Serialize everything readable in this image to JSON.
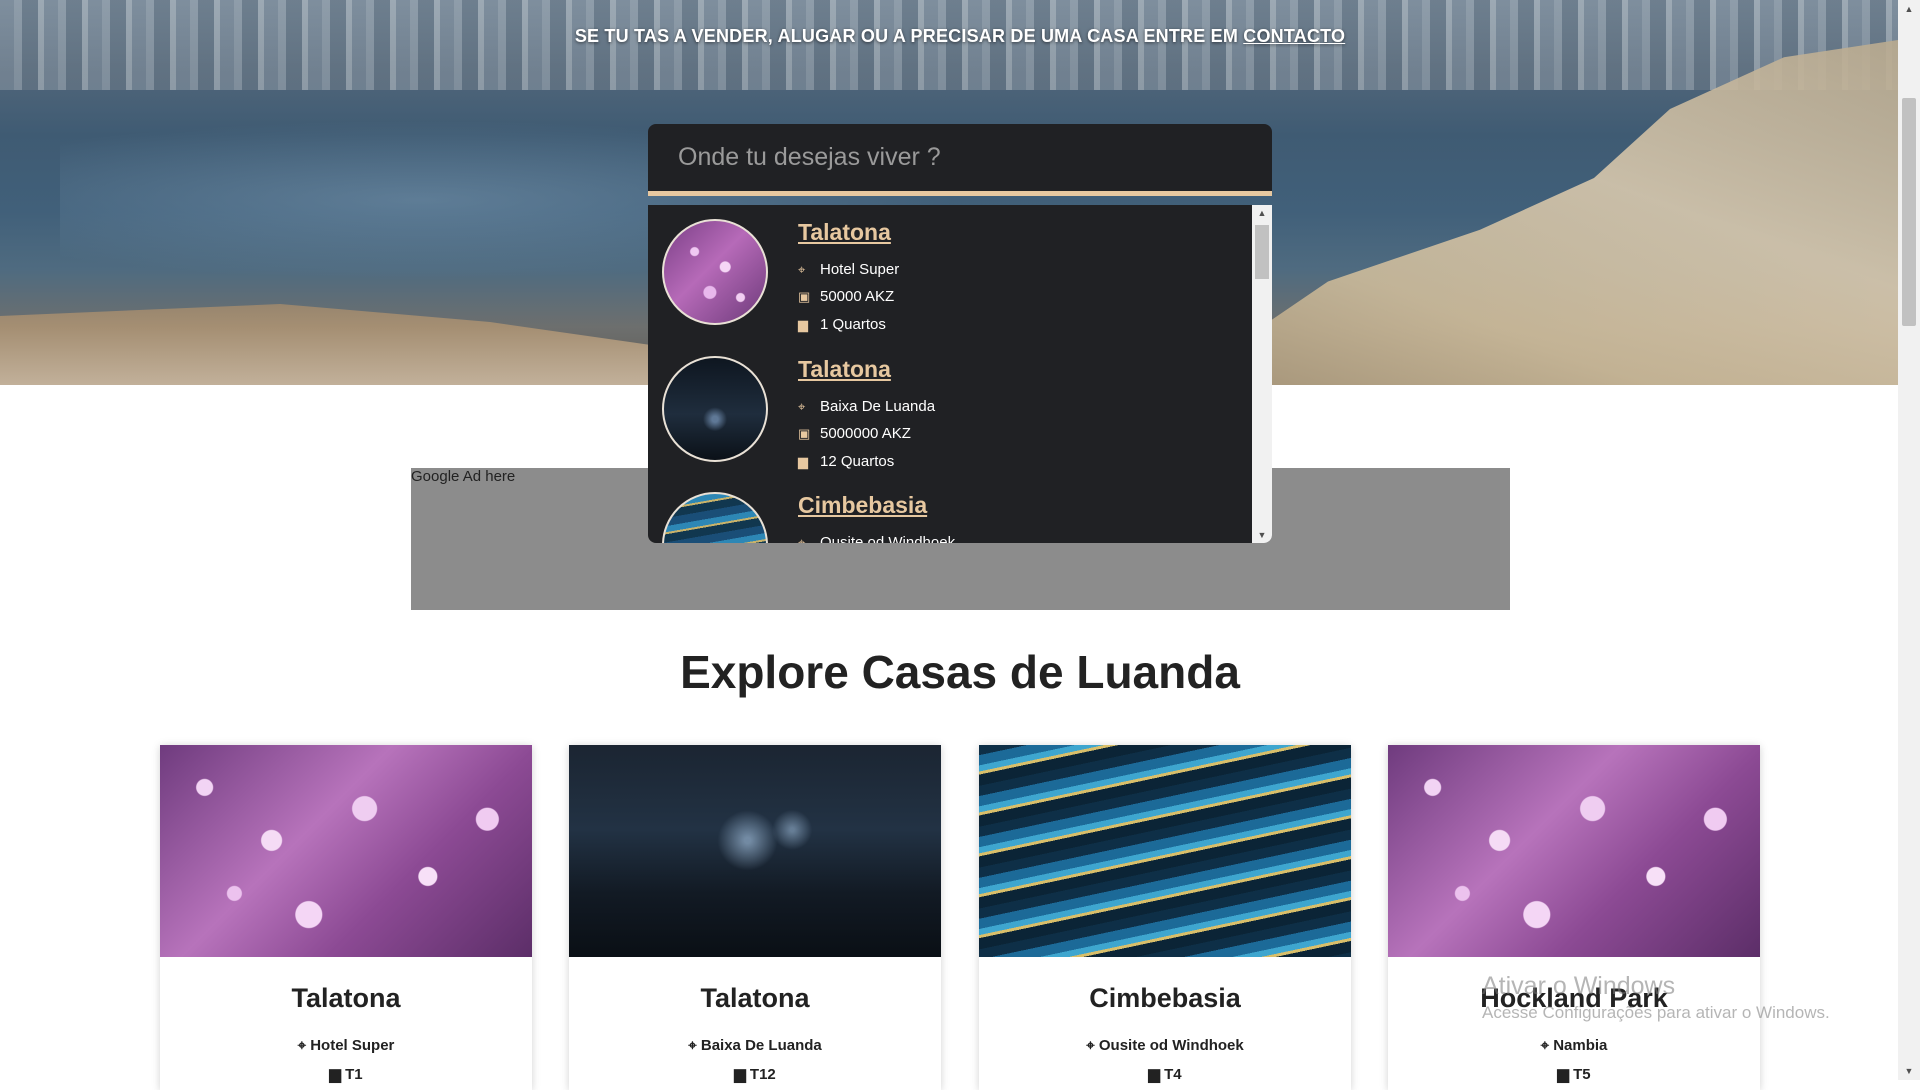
{
  "hero": {
    "headline": "SE TU TAS A VENDER, ALUGAR OU A PRECISAR DE UMA CASA ENTRE EM",
    "contact_link": "CONTACTO"
  },
  "search": {
    "placeholder": "Onde tu desejas viver ?",
    "value": ""
  },
  "results": [
    {
      "title": "Talatona",
      "location": "Hotel Super",
      "price": "50000 AKZ",
      "rooms": "1 Quartos",
      "thumb": "purple",
      "icons": {
        "location": "map-pin-icon",
        "price": "money-icon",
        "rooms": "bed-icon"
      }
    },
    {
      "title": "Talatona",
      "location": "Baixa De Luanda",
      "price": "5000000 AKZ",
      "rooms": "12 Quartos",
      "thumb": "dark"
    },
    {
      "title": "Cimbebasia",
      "location": "Ousite od Windhoek",
      "thumb": "ocean"
    }
  ],
  "ad": {
    "label": "Google Ad here"
  },
  "section": {
    "title": "Explore Casas de Luanda"
  },
  "cards": [
    {
      "title": "Talatona",
      "location": "Hotel Super",
      "rooms": "T1",
      "image": "purple"
    },
    {
      "title": "Talatona",
      "location": "Baixa De Luanda",
      "rooms": "T12",
      "image": "dark"
    },
    {
      "title": "Cimbebasia",
      "location": "Ousite od Windhoek",
      "rooms": "T4",
      "image": "ocean"
    },
    {
      "title": "Hockland Park",
      "location": "Nambia",
      "rooms": "T5",
      "image": "purple"
    }
  ],
  "watermark": {
    "line1": "Ativar o Windows",
    "line2": "Acesse Configurações para ativar o Windows."
  },
  "colors": {
    "accent": "#e7c8a0",
    "dropdown_bg": "#202124",
    "ad_bg": "#8c8c8c"
  }
}
